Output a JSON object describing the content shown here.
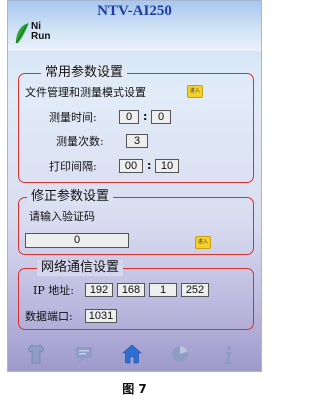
{
  "header": {
    "model": "NTV-AI250",
    "logo_line1": "Ni",
    "logo_line2": "Run"
  },
  "common_params": {
    "title": "常用参数设置",
    "file_mgmt_label": "文件管理和测量模式设置",
    "enter_label": "进入",
    "measure_time_label": "测量时间:",
    "measure_time_min": "0",
    "measure_time_sec": "0",
    "measure_count_label": "测量次数:",
    "measure_count": "3",
    "print_interval_label": "打印间隔:",
    "print_interval_min": "00",
    "print_interval_sec": "10"
  },
  "correction_params": {
    "title": "修正参数设置",
    "prompt": "请输入验证码",
    "code_value": "0",
    "enter_label": "进入"
  },
  "network": {
    "title": "网络通信设置",
    "ip_label": "IP 地址:",
    "ip": [
      "192",
      "168",
      "1",
      "252"
    ],
    "port_label": "数据端口:",
    "port": "1031"
  },
  "nav": {
    "items": [
      "shirt-icon",
      "message-icon",
      "home-icon",
      "chart-icon",
      "info-icon"
    ],
    "active": "home-icon"
  },
  "caption": "图 7"
}
